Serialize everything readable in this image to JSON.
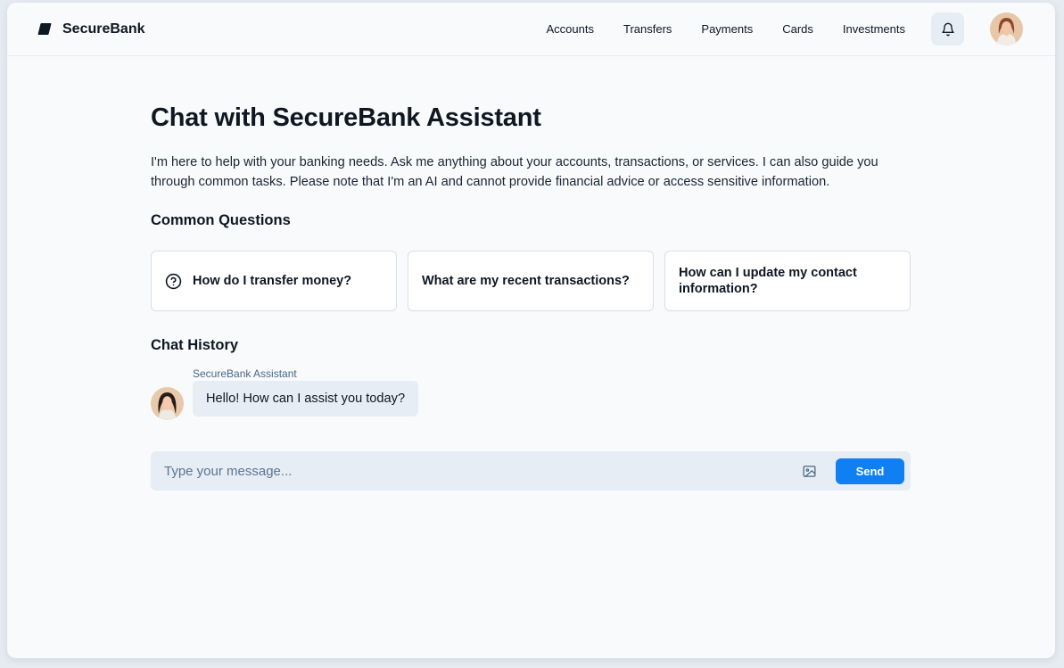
{
  "brand": {
    "name": "SecureBank"
  },
  "nav": {
    "items": [
      "Accounts",
      "Transfers",
      "Payments",
      "Cards",
      "Investments"
    ]
  },
  "page": {
    "title": "Chat with SecureBank Assistant",
    "intro": "I'm here to help with your banking needs. Ask me anything about your accounts, transactions, or services. I can also guide you through common tasks. Please note that I'm an AI and cannot provide financial advice or access sensitive information."
  },
  "questions": {
    "heading": "Common Questions",
    "items": [
      {
        "label": "How do I transfer money?",
        "icon": "question-circle-icon"
      },
      {
        "label": "What are my recent transactions?"
      },
      {
        "label": "How can I update my contact information?"
      }
    ]
  },
  "history": {
    "heading": "Chat History",
    "messages": [
      {
        "author": "SecureBank Assistant",
        "text": "Hello! How can I assist you today?"
      }
    ]
  },
  "composer": {
    "placeholder": "Type your message...",
    "send_label": "Send"
  },
  "colors": {
    "accent": "#0f7ff2",
    "surface": "#e7edf4",
    "background": "#f8fafc",
    "text": "#0f1722"
  }
}
